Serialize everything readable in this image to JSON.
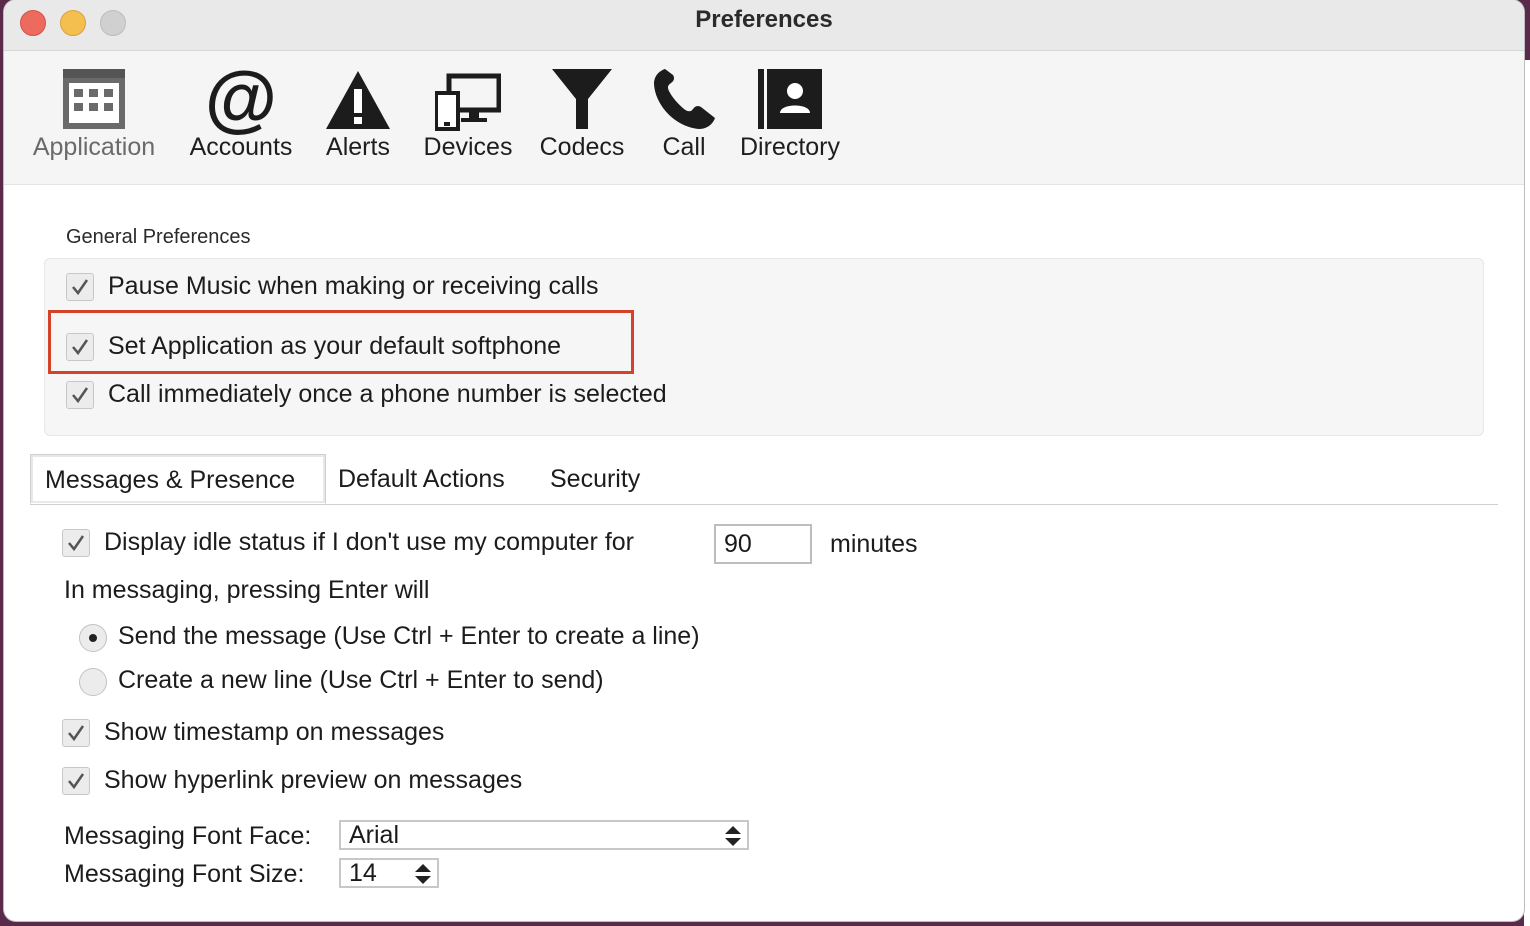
{
  "window": {
    "title": "Preferences"
  },
  "toolbar": {
    "items": [
      {
        "label": "Application",
        "icon": "calendar-grid-icon",
        "active": true
      },
      {
        "label": "Accounts",
        "icon": "at-sign-icon"
      },
      {
        "label": "Alerts",
        "icon": "warning-triangle-icon"
      },
      {
        "label": "Devices",
        "icon": "monitor-phone-icon"
      },
      {
        "label": "Codecs",
        "icon": "funnel-icon"
      },
      {
        "label": "Call",
        "icon": "phone-handset-icon"
      },
      {
        "label": "Directory",
        "icon": "contact-book-icon"
      }
    ]
  },
  "general": {
    "title": "General Preferences",
    "options": [
      {
        "label": "Pause Music when making or receiving calls",
        "checked": true
      },
      {
        "label": "Set Application as your default softphone",
        "checked": true,
        "highlighted": true
      },
      {
        "label": "Call immediately once a phone number is selected",
        "checked": true
      }
    ]
  },
  "tabs": [
    {
      "label": "Messages & Presence",
      "active": true
    },
    {
      "label": "Default Actions"
    },
    {
      "label": "Security"
    }
  ],
  "messages": {
    "idle": {
      "label": "Display idle status if I don't use my computer for",
      "value": "90",
      "unit": "minutes",
      "checked": true
    },
    "enter_heading": "In messaging, pressing Enter will",
    "radios": [
      {
        "label": "Send the message (Use Ctrl + Enter to create a line)",
        "selected": true
      },
      {
        "label": "Create a new line (Use Ctrl + Enter to send)",
        "selected": false
      }
    ],
    "timestamp": {
      "label": "Show timestamp on messages",
      "checked": true
    },
    "hyperlink": {
      "label": "Show hyperlink preview on messages",
      "checked": true
    },
    "font_face": {
      "label": "Messaging Font Face:",
      "value": "Arial"
    },
    "font_size": {
      "label": "Messaging Font Size:",
      "value": "14"
    }
  },
  "colors": {
    "highlight": "#d2432a",
    "close": "#ed6a5e",
    "minimize": "#f5bf4f"
  }
}
